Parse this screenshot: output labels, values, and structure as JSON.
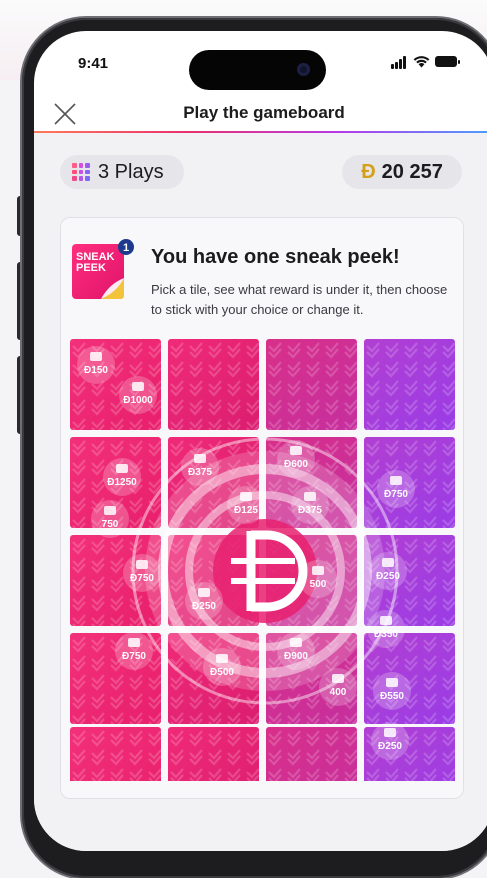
{
  "status_bar": {
    "time": "9:41"
  },
  "header": {
    "title": "Play the gameboard"
  },
  "stats": {
    "plays": "3 Plays",
    "coin_symbol": "Đ",
    "balance": "20 257"
  },
  "sneak_peek": {
    "badge_text": "SNEAK PEEK",
    "badge_line1": "SNEAK",
    "badge_line2": "PEEK",
    "badge_count": "1",
    "title": "You have one sneak peek!",
    "description": "Pick a tile, see what reward is under it, then choose to stick with your choice or change it."
  },
  "board": {
    "rows": 5,
    "cols": 4,
    "reward_icons": [
      {
        "label": "Đ150",
        "icon": "runner-icon"
      },
      {
        "label": "Đ1000",
        "icon": "fuel-icon"
      },
      {
        "label": "Đ1250",
        "icon": "basket-icon"
      },
      {
        "label": "Đ375",
        "icon": "drinks-icon"
      },
      {
        "label": "Đ600",
        "icon": "shirt-icon"
      },
      {
        "label": "Đ750",
        "icon": "hand-icon"
      },
      {
        "label": "750",
        "icon": "coin-icon"
      },
      {
        "label": "Đ125",
        "icon": "basket-icon"
      },
      {
        "label": "Đ375",
        "icon": "drinks-icon"
      },
      {
        "label": "Đ750",
        "icon": "hand-icon"
      },
      {
        "label": "Đ250",
        "icon": "drinks-icon"
      },
      {
        "label": "500",
        "icon": "coin-icon"
      },
      {
        "label": "Đ250",
        "icon": "fuel-icon"
      },
      {
        "label": "Đ350",
        "icon": "basket-icon"
      },
      {
        "label": "Đ750",
        "icon": "runner-icon"
      },
      {
        "label": "Đ500",
        "icon": "basket-icon"
      },
      {
        "label": "Đ900",
        "icon": "shirt-icon"
      },
      {
        "label": "400",
        "icon": "coin-icon"
      },
      {
        "label": "Đ550",
        "icon": "fuel-icon"
      },
      {
        "label": "Đ250",
        "icon": "shirt-icon"
      }
    ]
  },
  "colors": {
    "accent_pink": "#e8206e",
    "accent_purple": "#9a3ce6",
    "gold": "#d4a019"
  }
}
